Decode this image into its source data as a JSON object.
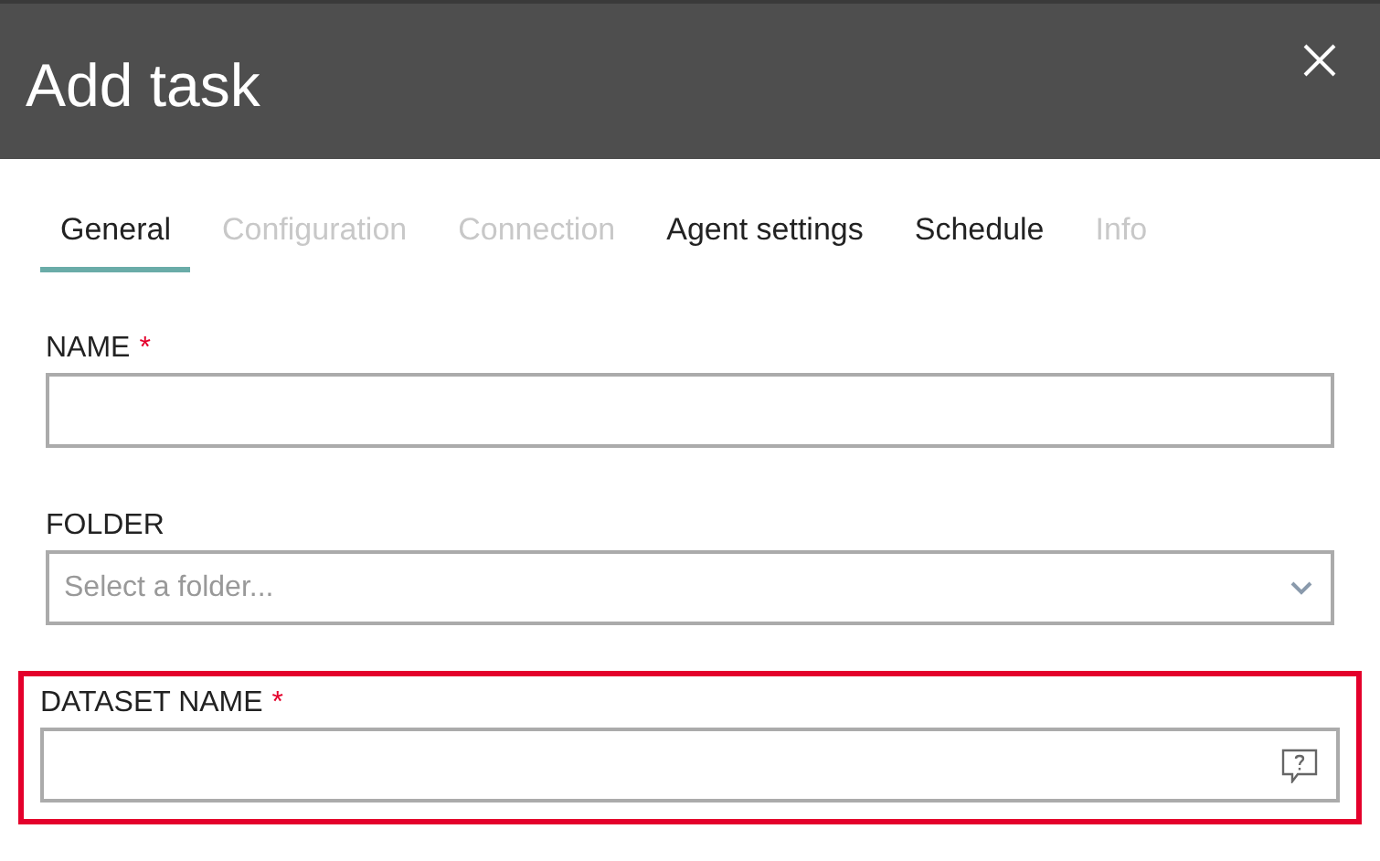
{
  "dialog": {
    "title": "Add task"
  },
  "tabs": [
    {
      "label": "General",
      "selected": true,
      "disabled": false
    },
    {
      "label": "Configuration",
      "selected": false,
      "disabled": true
    },
    {
      "label": "Connection",
      "selected": false,
      "disabled": true
    },
    {
      "label": "Agent settings",
      "selected": false,
      "disabled": false
    },
    {
      "label": "Schedule",
      "selected": false,
      "disabled": false
    },
    {
      "label": "Info",
      "selected": false,
      "disabled": true
    }
  ],
  "fields": [
    {
      "kind": "text",
      "label": "NAME",
      "required_mark": "*",
      "highlighted": false
    },
    {
      "kind": "select",
      "label": "FOLDER",
      "placeholder": "Select a folder...",
      "highlighted": false
    },
    {
      "kind": "help",
      "label": "DATASET NAME",
      "required_mark": "*",
      "highlighted": true
    }
  ]
}
